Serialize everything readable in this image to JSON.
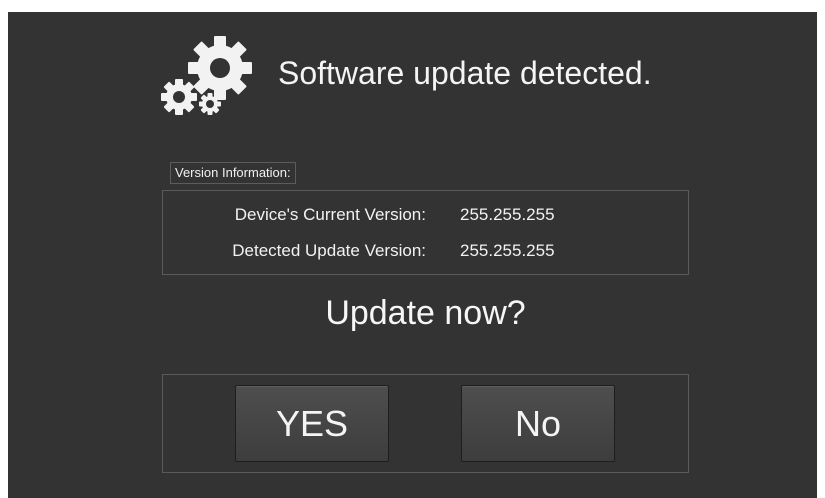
{
  "dialog": {
    "icon": "gears-icon",
    "title": "Software update detected."
  },
  "version_info": {
    "label": "Version Information:",
    "current_label": "Device's Current Version:",
    "current_value": "255.255.255",
    "detected_label": "Detected Update Version:",
    "detected_value": "255.255.255"
  },
  "prompt": "Update now?",
  "buttons": {
    "yes": "YES",
    "no": "No"
  },
  "colors": {
    "background": "#333333",
    "text": "#f2f2f2",
    "button": "#444444",
    "border": "#5a5a5a"
  }
}
